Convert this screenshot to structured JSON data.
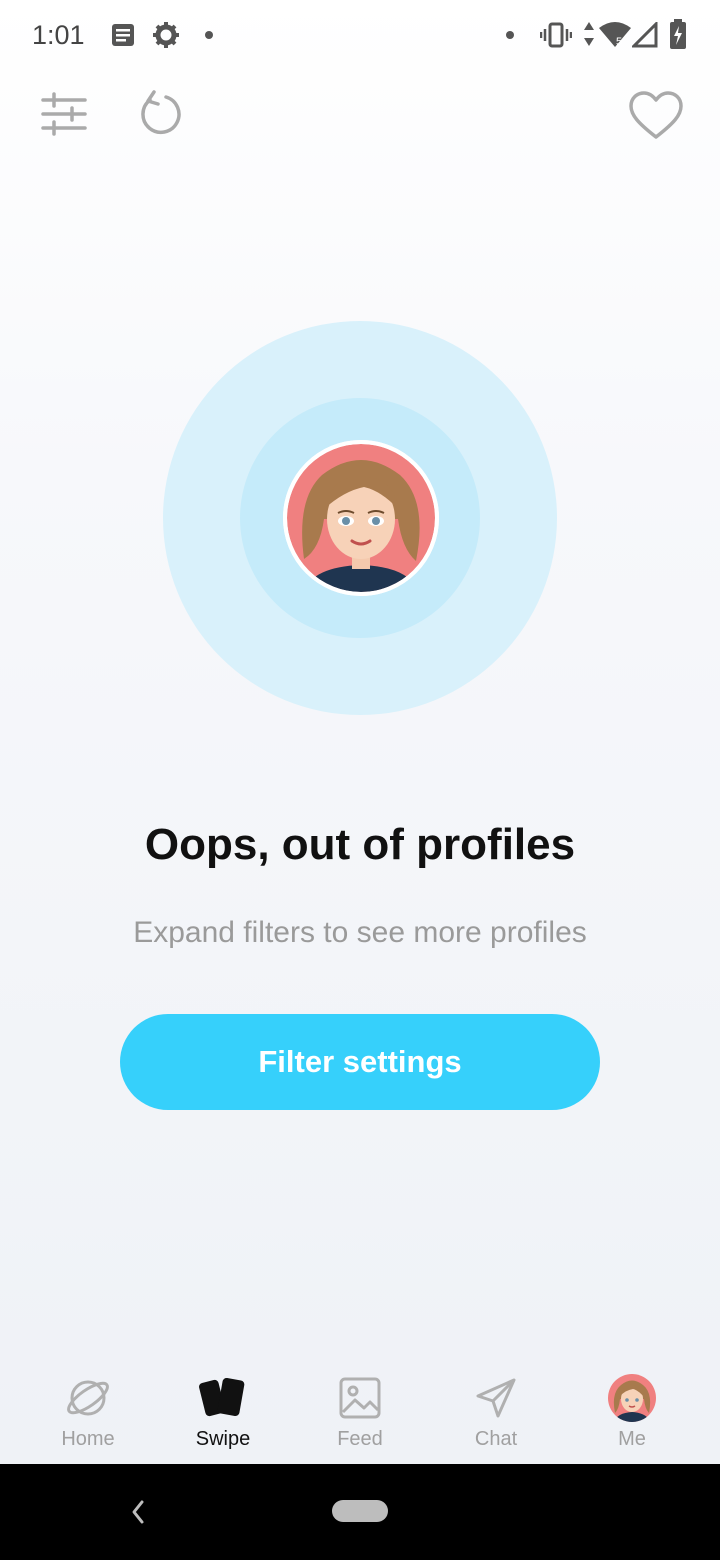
{
  "status_bar": {
    "time": "1:01",
    "icons": [
      "message-icon",
      "settings-gear-icon",
      "dot-icon",
      "vibrate-icon",
      "data-arrows-icon",
      "wifi-icon",
      "signal-icon",
      "battery-charging-icon"
    ]
  },
  "top_bar": {
    "icons": [
      "filters-sliders-icon",
      "undo-icon",
      "heart-icon"
    ]
  },
  "empty_state": {
    "title": "Oops, out of profiles",
    "subtitle": "Expand filters to see more profiles",
    "button_label": "Filter settings"
  },
  "bottom_nav": {
    "items": [
      {
        "label": "Home",
        "icon": "planet-icon"
      },
      {
        "label": "Swipe",
        "icon": "cards-icon",
        "active": true
      },
      {
        "label": "Feed",
        "icon": "image-icon"
      },
      {
        "label": "Chat",
        "icon": "send-icon"
      },
      {
        "label": "Me",
        "icon": "avatar-icon"
      }
    ]
  },
  "colors": {
    "accent": "#36d0fb",
    "radar_outer": "#d9f1fb",
    "radar_inner": "#c5ebfa",
    "avatar_bg": "#f08080"
  }
}
